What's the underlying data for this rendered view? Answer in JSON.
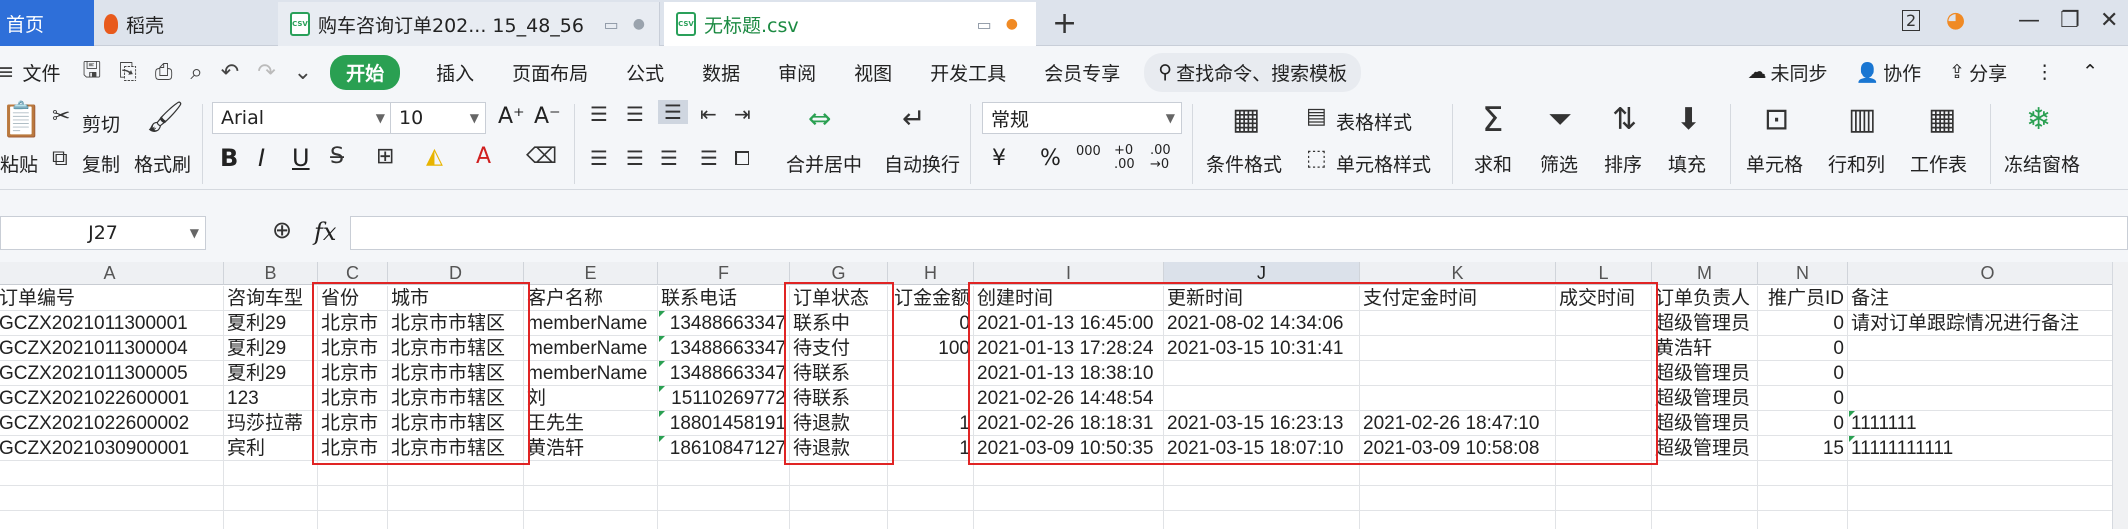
{
  "tabs": {
    "home": "首页",
    "daoke": "稻壳",
    "csv1": "购车咨询订单202... 15_48_56",
    "csv2": "无标题.csv",
    "count": "2"
  },
  "menu": {
    "file": "文件",
    "start": "开始",
    "items": [
      "插入",
      "页面布局",
      "公式",
      "数据",
      "审阅",
      "视图",
      "开发工具",
      "会员专享"
    ],
    "search": "查找命令、搜索模板",
    "right": [
      "未同步",
      "协作",
      "分享"
    ]
  },
  "ribbon": {
    "clipboard": {
      "paste": "粘贴",
      "cut": "剪切",
      "copy": "复制",
      "format_painter": "格式刷"
    },
    "font_name": "Arial",
    "font_size": "10",
    "font_grow": "A⁺",
    "font_shrink": "A⁻",
    "bold": "B",
    "italic": "I",
    "underline": "U",
    "merge": "合并居中",
    "wrap": "自动换行",
    "number_format": "常规",
    "currency": "¥",
    "percent": "%",
    "thousands": "000",
    "inc_dec": "+0 .00",
    "dec_dec": ".00 →0",
    "conditional": "条件格式",
    "table_style": "表格样式",
    "cell_style": "单元格样式",
    "sum": "求和",
    "filter": "筛选",
    "sort": "排序",
    "fill": "填充",
    "cells": "单元格",
    "rowcol": "行和列",
    "sheet": "工作表",
    "freeze": "冻结窗格"
  },
  "formula": {
    "cell_ref": "J27",
    "fx": "fx",
    "value": ""
  },
  "columns": [
    "A",
    "B",
    "C",
    "D",
    "E",
    "F",
    "G",
    "H",
    "I",
    "J",
    "K",
    "L",
    "M",
    "N",
    "O"
  ],
  "active_column": "J",
  "rows": [
    [
      "订单编号",
      "咨询车型",
      "省份",
      "城市",
      "客户名称",
      "联系电话",
      "订单状态",
      "订金金额",
      "创建时间",
      "更新时间",
      "支付定金时间",
      "成交时间",
      "订单负责人",
      "推广员ID",
      "备注"
    ],
    [
      "GCZX2021011300001",
      "夏利29",
      "北京市",
      "北京市市辖区",
      "memberName",
      "13488663347",
      "联系中",
      "0",
      "2021-01-13 16:45:00",
      "2021-08-02 14:34:06",
      "",
      "",
      "超级管理员",
      "0",
      "请对订单跟踪情况进行备注"
    ],
    [
      "GCZX2021011300004",
      "夏利29",
      "北京市",
      "北京市市辖区",
      "memberName",
      "13488663347",
      "待支付",
      "100",
      "2021-01-13 17:28:24",
      "2021-03-15 10:31:41",
      "",
      "",
      "黄浩轩",
      "0",
      ""
    ],
    [
      "GCZX2021011300005",
      "夏利29",
      "北京市",
      "北京市市辖区",
      "memberName",
      "13488663347",
      "待联系",
      "",
      "2021-01-13 18:38:10",
      "",
      "",
      "",
      "超级管理员",
      "0",
      ""
    ],
    [
      "GCZX2021022600001",
      "123",
      "北京市",
      "北京市市辖区",
      "刘",
      "15110269772",
      "待联系",
      "",
      "2021-02-26 14:48:54",
      "",
      "",
      "",
      "超级管理员",
      "0",
      ""
    ],
    [
      "GCZX2021022600002",
      "玛莎拉蒂",
      "北京市",
      "北京市市辖区",
      "王先生",
      "18801458191",
      "待退款",
      "1",
      "2021-02-26 18:18:31",
      "2021-03-15 16:23:13",
      "2021-02-26 18:47:10",
      "",
      "超级管理员",
      "0",
      "1111111"
    ],
    [
      "GCZX2021030900001",
      "宾利",
      "北京市",
      "北京市市辖区",
      "黄浩轩",
      "18610847127",
      "待退款",
      "1",
      "2021-03-09 10:50:35",
      "2021-03-15 18:07:10",
      "2021-03-09 10:58:08",
      "",
      "超级管理员",
      "15",
      "11111111111"
    ],
    [
      "",
      "",
      "",
      "",
      "",
      "",
      "",
      "",
      "",
      "",
      "",
      "",
      "",
      "",
      ""
    ],
    [
      "",
      "",
      "",
      "",
      "",
      "",
      "",
      "",
      "",
      "",
      "",
      "",
      "",
      "",
      ""
    ],
    [
      "",
      "",
      "",
      "",
      "",
      "",
      "",
      "",
      "",
      "",
      "",
      "",
      "",
      "",
      ""
    ]
  ],
  "colors": {
    "highlight_box": "#e02424",
    "accent": "#2aa052",
    "home_tab": "#2e6fd9"
  }
}
